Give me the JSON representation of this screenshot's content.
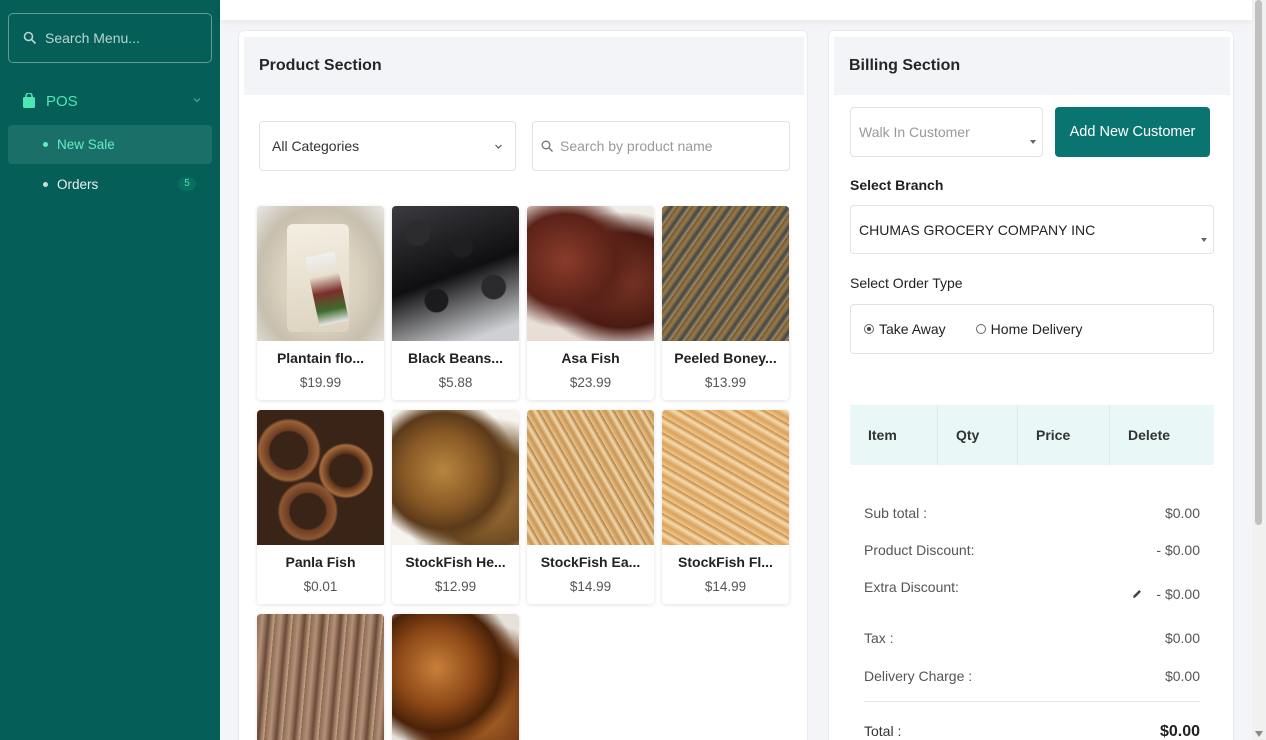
{
  "sidebar": {
    "search_placeholder": "Search Menu...",
    "pos_label": "POS",
    "items": [
      {
        "label": "New Sale"
      },
      {
        "label": "Orders",
        "badge": "5"
      }
    ]
  },
  "products": {
    "title": "Product Section",
    "category": "All Categories",
    "search_placeholder": "Search by product name",
    "items": [
      {
        "name": "Plantain flo...",
        "price": "$19.99"
      },
      {
        "name": "Black Beans...",
        "price": "$5.88"
      },
      {
        "name": "Asa Fish",
        "price": "$23.99"
      },
      {
        "name": "Peeled Boney...",
        "price": "$13.99"
      },
      {
        "name": "Panla Fish",
        "price": "$0.01"
      },
      {
        "name": "StockFish He...",
        "price": "$12.99"
      },
      {
        "name": "StockFish Ea...",
        "price": "$14.99"
      },
      {
        "name": "StockFish Fl...",
        "price": "$14.99"
      },
      {
        "name": "",
        "price": ""
      },
      {
        "name": "",
        "price": ""
      }
    ]
  },
  "billing": {
    "title": "Billing Section",
    "customer_placeholder": "Walk In Customer",
    "add_customer": "Add New Customer",
    "branch_label": "Select Branch",
    "branch_value": "CHUMAS GROCERY COMPANY INC",
    "order_type_label": "Select Order Type",
    "order_types": [
      {
        "label": "Take Away",
        "selected": true
      },
      {
        "label": "Home Delivery",
        "selected": false
      }
    ],
    "columns": [
      "Item",
      "Qty",
      "Price",
      "Delete"
    ],
    "summary": {
      "subtotal_label": "Sub total :",
      "subtotal": "$0.00",
      "product_discount_label": "Product Discount:",
      "product_discount": "- $0.00",
      "extra_discount_label": "Extra Discount:",
      "extra_discount": "- $0.00",
      "tax_label": "Tax :",
      "tax": "$0.00",
      "delivery_label": "Delivery Charge :",
      "delivery": "$0.00",
      "total_label": "Total :",
      "total": "$0.00"
    }
  },
  "colors": {
    "sidebar_bg": "#055e58",
    "accent": "#0a7570",
    "active_text": "#5ff0bf"
  }
}
